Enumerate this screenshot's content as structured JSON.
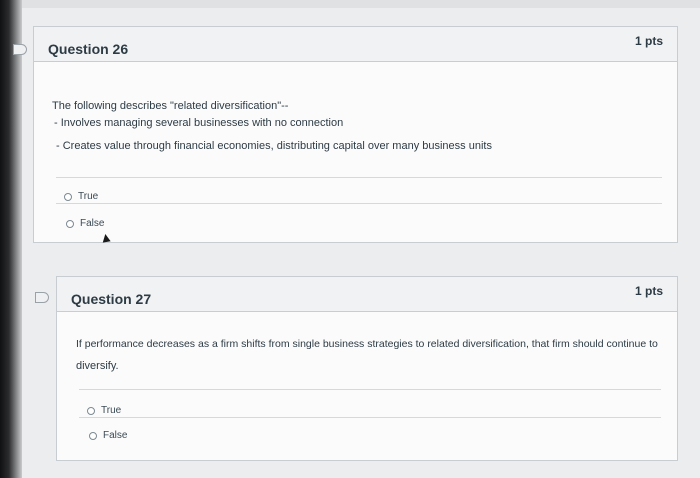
{
  "q26": {
    "title": "Question 26",
    "points": "1 pts",
    "text_line1": "The following describes \"related diversification\"--",
    "text_line2": "- Involves managing several businesses with no connection",
    "text_line3": "- Creates value through financial economies, distributing capital over many business units",
    "answers": [
      {
        "label": "True"
      },
      {
        "label": "False"
      }
    ]
  },
  "q27": {
    "title": "Question 27",
    "points": "1 pts",
    "text_line1": "If performance decreases as a firm shifts from single business strategies to related diversification, that firm should continue to",
    "text_line2": "diversify.",
    "answers": [
      {
        "label": "True"
      },
      {
        "label": "False"
      }
    ]
  },
  "icons": {
    "bookmark": "bookmark-icon",
    "radio": "radio-icon",
    "cursor": "mouse-cursor-icon"
  }
}
